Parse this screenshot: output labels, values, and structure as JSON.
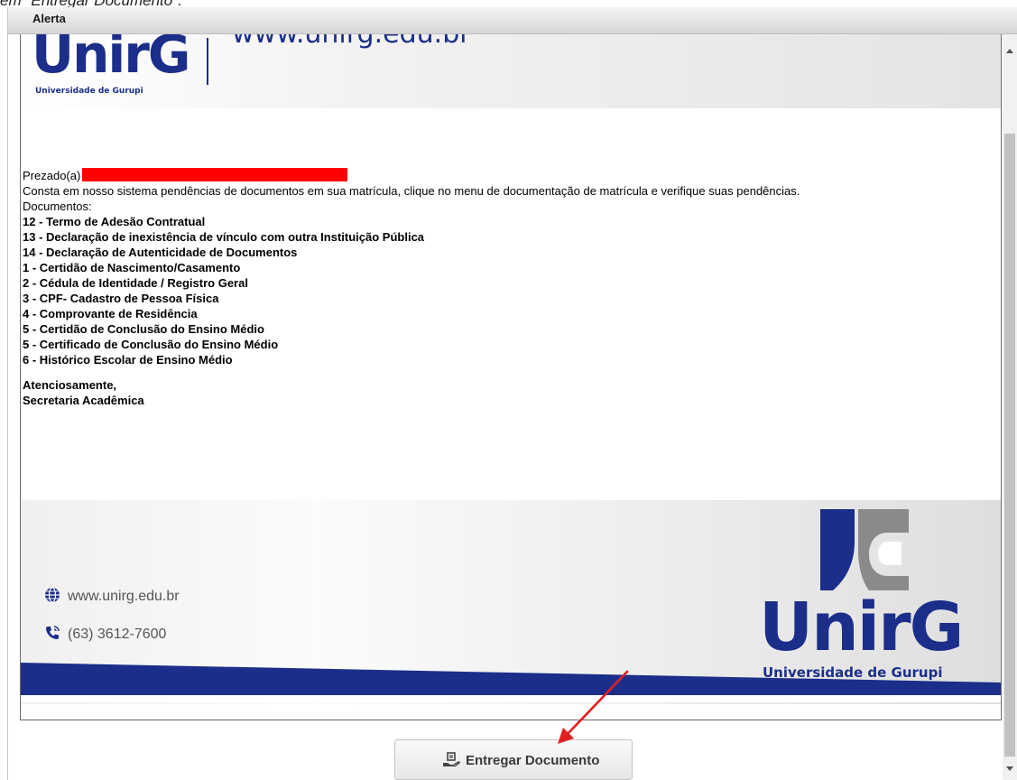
{
  "page_caption": "em \"Entregar Documento\".",
  "dialog": {
    "title": "Alerta"
  },
  "header": {
    "logo_word": "UnirG",
    "logo_subtitle": "Universidade de Gurupi",
    "url_fragment": "www.unirg.edu.br"
  },
  "letter": {
    "greeting": "Prezado(a)",
    "redacted_name": "",
    "intro": "Consta em nosso sistema pendências de documentos em sua matrícula, clique no menu de documentação de matrícula e verifique suas pendências.",
    "docs_heading": "Documentos:",
    "documents": [
      "12 - Termo de Adesão Contratual",
      "13 - Declaração de inexistência de vínculo com outra Instituição Pública",
      "14 - Declaração de Autenticidade de Documentos",
      "1 - Certidão de Nascimento/Casamento",
      "2 - Cédula de Identidade / Registro Geral",
      "3 - CPF- Cadastro de Pessoa Física",
      "4 - Comprovante de Residência",
      "5 - Certidão de Conclusão do Ensino Médio",
      "5 - Certificado de Conclusão do Ensino Médio",
      "6 - Histórico Escolar de Ensino Médio"
    ],
    "closing": "Atenciosamente,",
    "signature": "Secretaria Acadêmica"
  },
  "footer": {
    "website": "www.unirg.edu.br",
    "phone": "(63) 3612-7600",
    "logo_word": "UnirG",
    "logo_subtitle": "Universidade de Gurupi"
  },
  "actions": {
    "deliver_button_label": "Entregar Documento"
  },
  "colors": {
    "brand_blue": "#1b2e8a",
    "brand_gray": "#8a8a8a",
    "annotation_red": "#e02020",
    "redaction_red": "#ff0000"
  },
  "icons": {
    "globe": "globe-icon",
    "phone": "phone-icon",
    "deliver": "document-hand-icon"
  }
}
